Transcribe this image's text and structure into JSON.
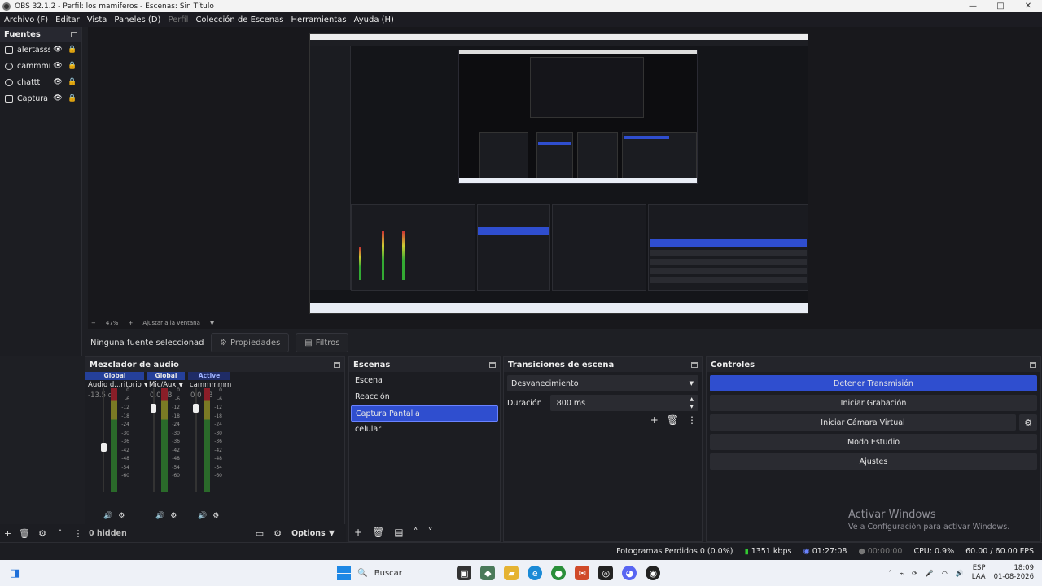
{
  "window": {
    "title": "OBS 32.1.2 - Perfil: los mamiferos - Escenas: Sin Título",
    "minimize": "—",
    "maximize": "□",
    "close": "✕"
  },
  "menu": [
    "Archivo (F)",
    "Editar",
    "Vista",
    "Paneles (D)",
    "Perfil",
    "Colección de Escenas",
    "Herramientas",
    "Ayuda (H)"
  ],
  "sources": {
    "title": "Fuentes",
    "items": [
      {
        "label": "alertasss",
        "icon": "image-icon"
      },
      {
        "label": "cammmm",
        "icon": "camera-icon"
      },
      {
        "label": "chattt",
        "icon": "browser-icon"
      },
      {
        "label": "Captura d",
        "icon": "monitor-icon"
      }
    ]
  },
  "zoom": {
    "minus": "−",
    "value": "47%",
    "plus": "+",
    "fit": "Ajustar a la ventana",
    "arrow": "▼"
  },
  "selection": {
    "none": "Ninguna fuente seleccionada",
    "properties": "Propiedades",
    "filters": "Filtros"
  },
  "mixer": {
    "title": "Mezclador de audio",
    "channels": [
      {
        "header": "Global",
        "name": "Audio d...ritorio",
        "db": "-13.5 dB",
        "level": 0.2
      },
      {
        "header": "Global",
        "name": "Mic/Aux",
        "db": "0.0 dB",
        "level": 0.0
      },
      {
        "header": "Active",
        "name": "cammmmm",
        "db": "0.0 dB",
        "level": 0.0
      }
    ],
    "scale": [
      "0",
      "-6",
      "-12",
      "-18",
      "-24",
      "-30",
      "-36",
      "-42",
      "-48",
      "-54",
      "-60"
    ],
    "hidden": "0 hidden",
    "options": "Options"
  },
  "scenes": {
    "title": "Escenas",
    "items": [
      "Escena",
      "Reacción",
      "Captura Pantalla",
      "celular"
    ],
    "selected": "Captura Pantalla"
  },
  "transitions": {
    "title": "Transiciones de escena",
    "type": "Desvanecimiento",
    "duration_label": "Duración",
    "duration": "800 ms"
  },
  "controls": {
    "title": "Controles",
    "stop_stream": "Detener Transmisión",
    "start_record": "Iniciar Grabación",
    "virtual_cam": "Iniciar Cámara Virtual",
    "studio": "Modo Estudio",
    "settings": "Ajustes"
  },
  "activate": {
    "line1": "Activar Windows",
    "line2": "Ve a Configuración para activar Windows."
  },
  "status": {
    "dropped": "Fotogramas Perdidos 0 (0.0%)",
    "bitrate": "1351 kbps",
    "stream_time": "01:27:08",
    "rec_time": "00:00:00",
    "cpu": "CPU: 0.9%",
    "fps": "60.00 / 60.00 FPS"
  },
  "taskbar": {
    "search": "Buscar",
    "lang1": "ESP",
    "lang2": "LAA",
    "time": "18:09",
    "date": "01-08-2026"
  },
  "colors": {
    "accent": "#2f4ecf",
    "panel": "#1c1d22",
    "dark": "#18181c"
  }
}
